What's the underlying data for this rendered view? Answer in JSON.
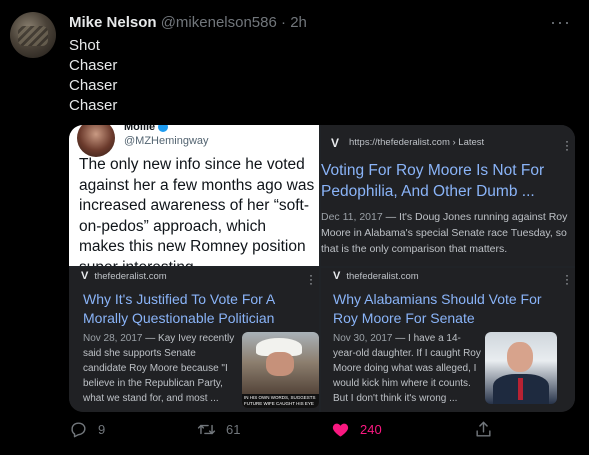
{
  "tweet": {
    "author_name": "Mike Nelson",
    "author_handle": "@mikenelson586",
    "separator": "·",
    "time": "2h",
    "lines": [
      "Shot",
      "Chaser",
      "Chaser",
      "Chaser"
    ]
  },
  "media": {
    "quoted_tweet": {
      "name": "Mollie",
      "handle": "@MZHemingway",
      "body": "The only new info since he voted against her a few months ago was increased awareness of her “soft-on-pedos” approach, which makes this new Romney position super interesting"
    },
    "link_1": {
      "source": "https://thefederalist.com › Latest",
      "logo": "V",
      "title": "Voting For Roy Moore Is Not For Pedophilia, And Other Dumb ...",
      "date": "Dec 11, 2017",
      "snippet": " — It's Doug Jones running against Roy Moore in Alabama's special Senate race Tuesday, so that is the only comparison that matters."
    },
    "link_2": {
      "source": "thefederalist.com",
      "logo": "V",
      "title": "Why It's Justified To Vote For A Morally Questionable Politician",
      "date": "Nov 28, 2017",
      "snippet": " — Kay Ivey recently said she supports Senate candidate Roy Moore because \"I believe in the Republican Party, what we stand for, and most ...",
      "thumb_caption": "IN HIS OWN WORDS, SUGGESTS FUTURE WIFE CAUGHT HIS EYE WHEN SHE WAS A TEEN"
    },
    "link_3": {
      "source": "thefederalist.com",
      "logo": "V",
      "title": "Why Alabamians Should Vote For Roy Moore For Senate",
      "date": "Nov 30, 2017",
      "snippet": " — I have a 14-year-old daughter. If I caught Roy Moore doing what was alleged, I would kick him where it counts. But I don't think it's wrong ..."
    }
  },
  "actions": {
    "reply_count": "9",
    "retweet_count": "61",
    "like_count": "240"
  },
  "colors": {
    "like_active": "#f91880",
    "link_title": "#8ab4f8",
    "muted": "#71767b"
  }
}
